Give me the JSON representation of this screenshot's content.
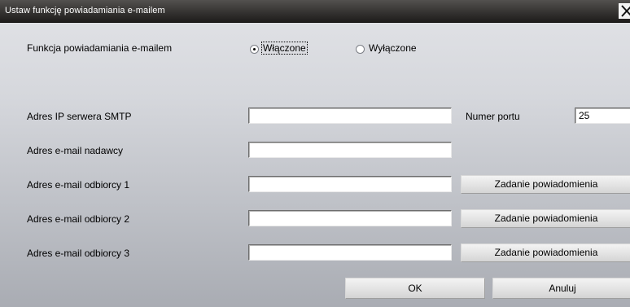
{
  "window": {
    "title": "Ustaw funkcję powiadamiania e-mailem",
    "close_glyph": "X"
  },
  "notification": {
    "label": "Funkcja powiadamiania e-mailem",
    "options": [
      {
        "label": "Włączone",
        "checked": true
      },
      {
        "label": "Wyłączone",
        "checked": false
      }
    ]
  },
  "smtp": {
    "label": "Adres IP serwera SMTP",
    "value": ""
  },
  "port": {
    "label": "Numer portu",
    "value": "25"
  },
  "sender": {
    "label": "Adres e-mail nadawcy",
    "value": ""
  },
  "recipients": [
    {
      "label": "Adres e-mail odbiorcy 1",
      "value": "",
      "button": "Zadanie powiadomienia"
    },
    {
      "label": "Adres e-mail odbiorcy 2",
      "value": "",
      "button": "Zadanie powiadomienia"
    },
    {
      "label": "Adres e-mail odbiorcy 3",
      "value": "",
      "button": "Zadanie powiadomienia"
    }
  ],
  "buttons": {
    "ok": "OK",
    "cancel": "Anuluj"
  }
}
